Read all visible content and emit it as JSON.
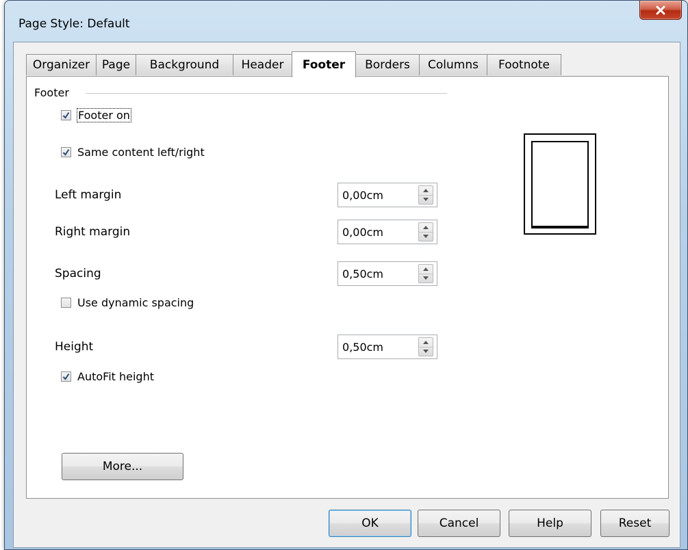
{
  "window": {
    "title": "Page Style: Default"
  },
  "tabs": [
    "Organizer",
    "Page",
    "Background",
    "Header",
    "Footer",
    "Borders",
    "Columns",
    "Footnote"
  ],
  "active_tab": "Footer",
  "footer_group": {
    "label": "Footer"
  },
  "checkboxes": {
    "footer_on": {
      "label": "Footer on",
      "checked": true
    },
    "same_content": {
      "label": "Same content left/right",
      "checked": true
    },
    "dynamic_spacing": {
      "label": "Use dynamic spacing",
      "checked": false
    },
    "autofit_height": {
      "label": "AutoFit height",
      "checked": true
    }
  },
  "fields": {
    "left_margin": {
      "label": "Left margin",
      "value": "0,00cm"
    },
    "right_margin": {
      "label": "Right margin",
      "value": "0,00cm"
    },
    "spacing": {
      "label": "Spacing",
      "value": "0,50cm"
    },
    "height": {
      "label": "Height",
      "value": "0,50cm"
    }
  },
  "more_button": "More...",
  "buttons": {
    "ok": "OK",
    "cancel": "Cancel",
    "help": "Help",
    "reset": "Reset"
  },
  "colors": {
    "title_gradient": "#b6d0e8",
    "close_red": "#c4462d",
    "default_button_border": "#3c7fb1"
  }
}
